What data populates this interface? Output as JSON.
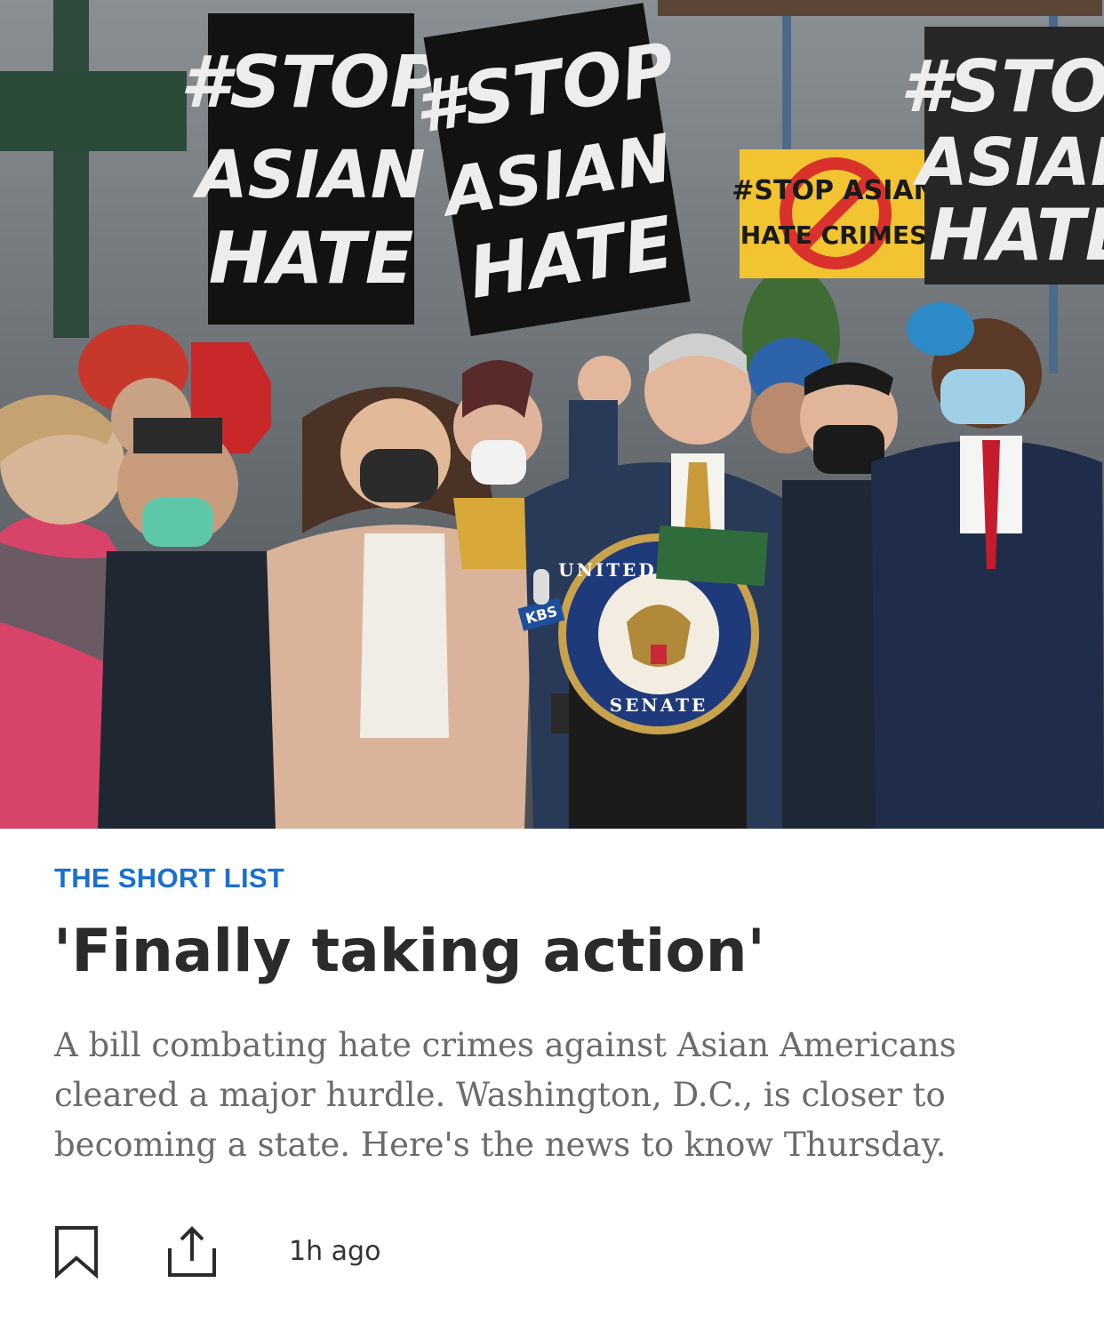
{
  "hero": {
    "image_description_icon": "photo-press-conference",
    "signs": [
      {
        "line1": "#STOP",
        "line2": "ASIAN",
        "line3": "HATE"
      },
      {
        "line1": "#STOP",
        "line2": "ASIAN",
        "line3": "HATE"
      },
      {
        "line1": "#STOP ASIAN",
        "line2": "HATE CRIMES"
      },
      {
        "line1": "#STOP",
        "line2": "ASIAN",
        "line3": "HATE"
      }
    ],
    "seal": {
      "top_text": "UNITED STATES",
      "bottom_text": "SENATE"
    },
    "mic_label": "KBS"
  },
  "article": {
    "section": "THE SHORT LIST",
    "headline": "'Finally taking action'",
    "summary": "A bill combating hate crimes against Asian Americans cleared a major hurdle. Washington, D.C., is closer to becoming a state. Here's the news to know Thursday.",
    "timestamp": "1h ago"
  },
  "actions": {
    "bookmark_icon": "bookmark-icon",
    "share_icon": "share-icon"
  },
  "colors": {
    "section_blue": "#1b6fcf",
    "headline": "#2b2b2b",
    "summary": "#6b6b6b"
  }
}
